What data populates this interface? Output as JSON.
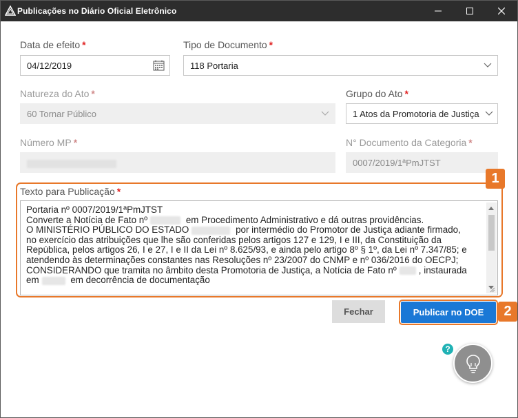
{
  "window": {
    "title": "Publicações no Diário Oficial Eletrônico",
    "app_icon": "triangle-logo-icon",
    "controls": [
      "minimize-icon",
      "maximize-icon",
      "close-icon"
    ]
  },
  "form": {
    "data_efeito": {
      "label": "Data de efeito",
      "required": "*",
      "value": "04/12/2019",
      "icon": "calendar-icon"
    },
    "tipo_documento": {
      "label": "Tipo de Documento",
      "required": "*",
      "value": "118 Portaria",
      "icon": "chevron-down-icon"
    },
    "natureza_ato": {
      "label": "Natureza do Ato",
      "required": "*",
      "value": "60 Tornar Público",
      "icon": "chevron-down-icon"
    },
    "grupo_ato": {
      "label": "Grupo do Ato",
      "required": "*",
      "value": "1 Atos da Promotoria de Justiça",
      "icon": "chevron-down-icon"
    },
    "numero_mp": {
      "label": "Número MP",
      "required": "*",
      "value": ""
    },
    "numero_documento": {
      "label": "N° Documento da Categoria",
      "required": "*",
      "value": "0007/2019/1ªPmJTST"
    },
    "texto_publicacao": {
      "label": "Texto para Publicação",
      "required": "*",
      "lines": [
        [
          "Portaria nº 0007/2019/1ªPmJTST"
        ],
        [
          "Converte a Notícia de Fato nº",
          " em Procedimento Administrativo e dá outras providências."
        ],
        [
          "O MINISTÉRIO PÚBLICO DO ESTADO",
          " por intermédio do Promotor de Justiça adiante firmado,"
        ],
        [
          "no exercício das atribuições que lhe são conferidas pelos artigos 127 e 129, I e III, da Constituição da"
        ],
        [
          "República, pelos artigos 26, I e 27, I e II da Lei nº 8.625/93, e ainda pelo artigo 8º § 1º, da Lei nº 7.347/85; e"
        ],
        [
          "atendendo às determinações constantes nas Resoluções nº 23/2007 do CNMP e nº 036/2016 do OECPJ;"
        ],
        [
          "CONSIDERANDO que tramita no âmbito desta Promotoria de Justiça, a Notícia de Fato nº",
          ", instaurada"
        ],
        [
          "em",
          " em decorrência de documentação"
        ]
      ]
    }
  },
  "annotations": {
    "badge_1": "1",
    "badge_2": "2"
  },
  "buttons": {
    "fechar": "Fechar",
    "publicar": "Publicar no DOE"
  },
  "help": {
    "symbol": "?"
  },
  "colors": {
    "accent_orange": "#e8782a",
    "primary_blue": "#1a78d6",
    "titlebar": "#2d2d2d",
    "required_red": "#e02020"
  }
}
